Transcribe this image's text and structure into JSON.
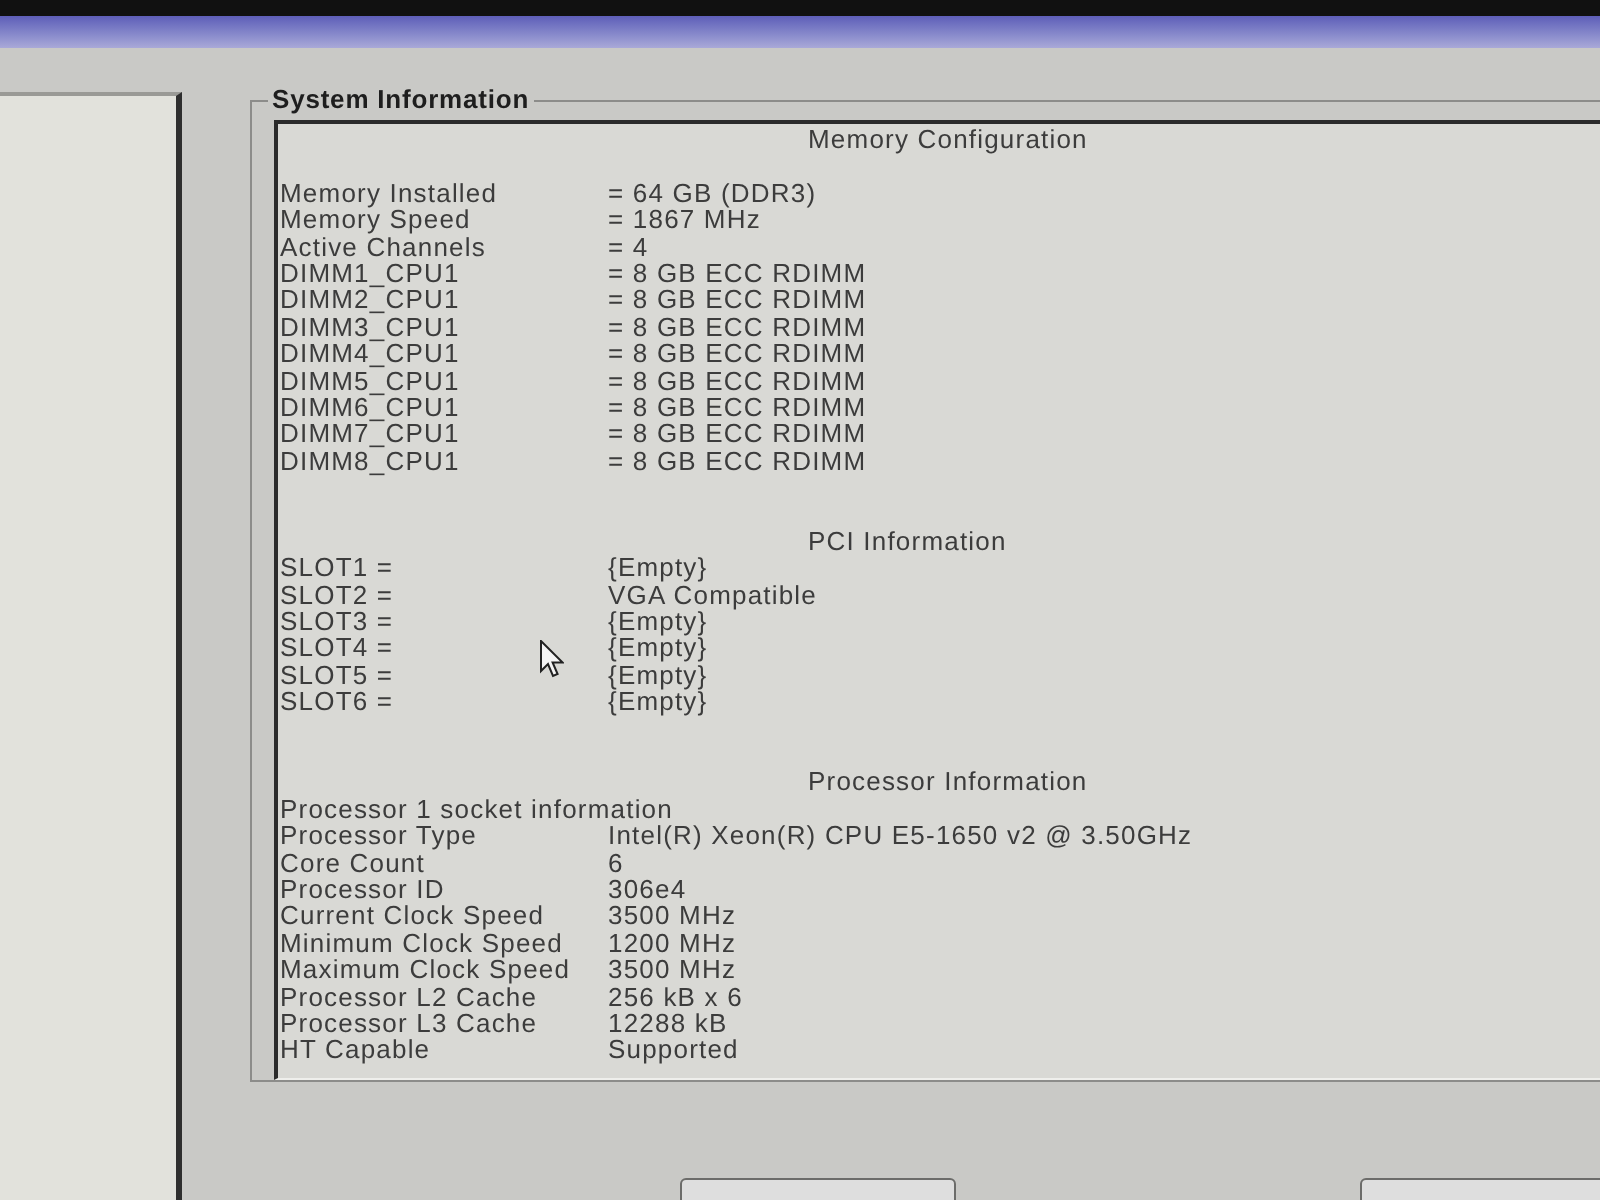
{
  "group": {
    "title": "System Information",
    "sections": [
      {
        "heading": "Memory Configuration",
        "rows": [
          {
            "label": "Memory Installed",
            "value": "= 64 GB (DDR3)"
          },
          {
            "label": "Memory Speed",
            "value": "= 1867 MHz"
          },
          {
            "label": "Active Channels",
            "value": "= 4"
          },
          {
            "label": "DIMM1_CPU1",
            "value": "= 8 GB ECC RDIMM"
          },
          {
            "label": "DIMM2_CPU1",
            "value": "= 8 GB ECC RDIMM"
          },
          {
            "label": "DIMM3_CPU1",
            "value": "= 8 GB ECC RDIMM"
          },
          {
            "label": "DIMM4_CPU1",
            "value": "= 8 GB ECC RDIMM"
          },
          {
            "label": "DIMM5_CPU1",
            "value": "= 8 GB ECC RDIMM"
          },
          {
            "label": "DIMM6_CPU1",
            "value": "= 8 GB ECC RDIMM"
          },
          {
            "label": "DIMM7_CPU1",
            "value": "= 8 GB ECC RDIMM"
          },
          {
            "label": "DIMM8_CPU1",
            "value": "= 8 GB ECC RDIMM"
          }
        ]
      },
      {
        "heading": "PCI Information",
        "rows": [
          {
            "label": "SLOT1 =",
            "value": "{Empty}"
          },
          {
            "label": "SLOT2 =",
            "value": "VGA Compatible"
          },
          {
            "label": "SLOT3 =",
            "value": "{Empty}"
          },
          {
            "label": "SLOT4 =",
            "value": "{Empty}"
          },
          {
            "label": "SLOT5 =",
            "value": "{Empty}"
          },
          {
            "label": "SLOT6 =",
            "value": "{Empty}"
          }
        ]
      },
      {
        "heading": "Processor Information",
        "rows": [
          {
            "label": "Processor 1 socket information"
          },
          {
            "label": "Processor Type",
            "value": "Intel(R) Xeon(R) CPU E5-1650 v2 @ 3.50GHz"
          },
          {
            "label": "Core Count",
            "value": "6"
          },
          {
            "label": "Processor ID",
            "value": "306e4"
          },
          {
            "label": "Current Clock Speed",
            "value": "3500 MHz"
          },
          {
            "label": "Minimum Clock Speed",
            "value": "1200 MHz"
          },
          {
            "label": "Maximum Clock Speed",
            "value": "3500 MHz"
          },
          {
            "label": "Processor L2 Cache",
            "value": "256 kB x 6"
          },
          {
            "label": "Processor L3 Cache",
            "value": "12288 kB"
          },
          {
            "label": "HT Capable",
            "value": "Supported"
          }
        ]
      }
    ]
  }
}
